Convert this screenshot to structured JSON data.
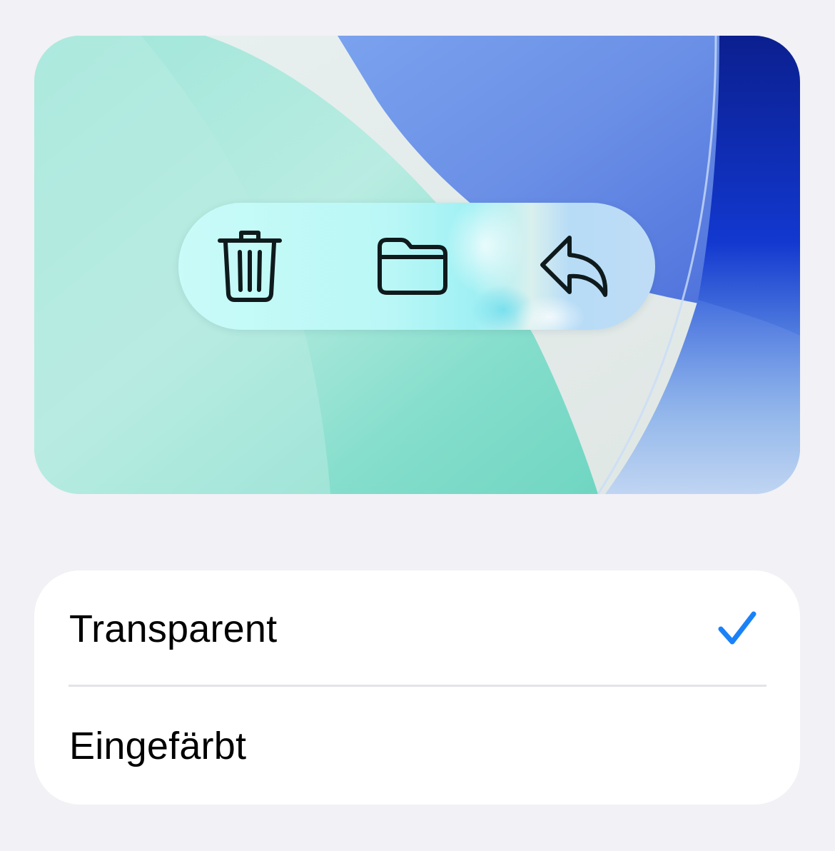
{
  "preview": {
    "toolbar": {
      "buttons": [
        {
          "name": "trash-icon"
        },
        {
          "name": "folder-icon"
        },
        {
          "name": "reply-icon"
        }
      ]
    }
  },
  "options": {
    "items": [
      {
        "label": "Transparent",
        "selected": true
      },
      {
        "label": "Eingefärbt",
        "selected": false
      }
    ],
    "accent_color": "#1a82f8"
  }
}
